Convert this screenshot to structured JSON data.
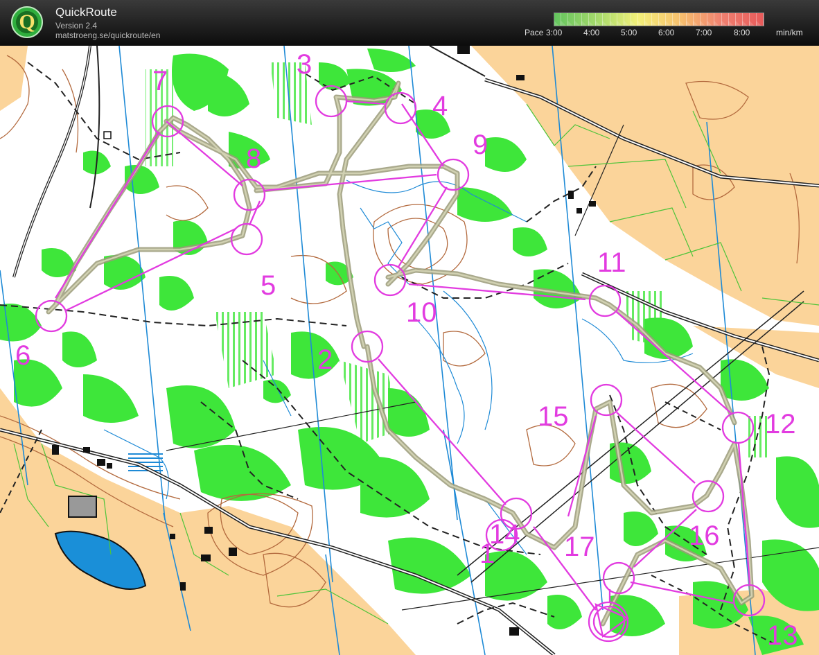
{
  "app": {
    "title": "QuickRoute",
    "version": "Version 2.4",
    "url": "matstroeng.se/quickroute/en",
    "logo_letter": "Q"
  },
  "pace_legend": {
    "prefix": "Pace",
    "ticks": [
      "3:00",
      "4:00",
      "5:00",
      "6:00",
      "7:00",
      "8:00"
    ],
    "unit": "min/km",
    "gradient_colors": [
      "#63c45e",
      "#a3d96b",
      "#f3f07a",
      "#f6c06e",
      "#ef8070",
      "#e85a5a"
    ]
  },
  "map": {
    "colors": {
      "course": "#e23be0",
      "route": "#9a9a78",
      "vegetation": "#3ee63a",
      "field": "#fbd49a",
      "contour": "#b36a3e",
      "water": "#1e8ad6",
      "lake": "#1a8fd8"
    },
    "controls": [
      {
        "number": "1"
      },
      {
        "number": "2"
      },
      {
        "number": "3"
      },
      {
        "number": "4"
      },
      {
        "number": "5"
      },
      {
        "number": "6"
      },
      {
        "number": "7"
      },
      {
        "number": "8"
      },
      {
        "number": "9"
      },
      {
        "number": "10"
      },
      {
        "number": "11"
      },
      {
        "number": "12"
      },
      {
        "number": "13"
      },
      {
        "number": "14"
      },
      {
        "number": "15"
      },
      {
        "number": "16"
      },
      {
        "number": "17"
      }
    ]
  }
}
